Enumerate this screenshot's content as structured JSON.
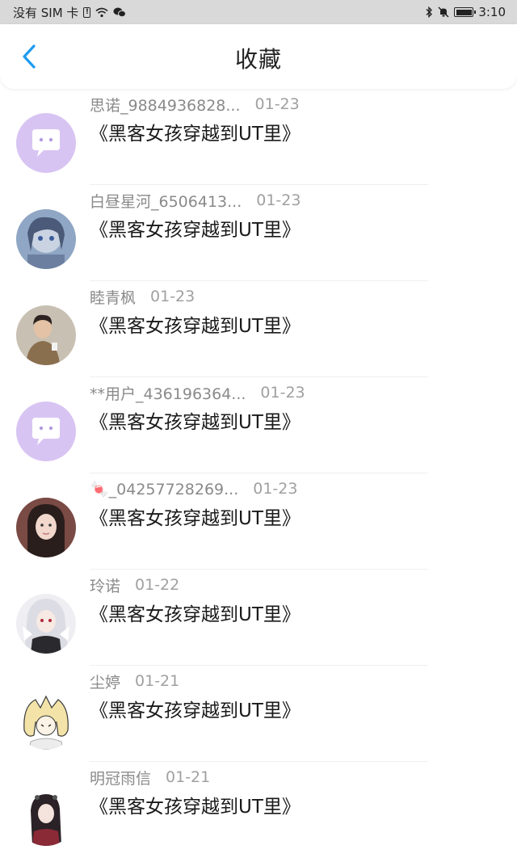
{
  "status_bar": {
    "carrier": "没有 SIM 卡",
    "time": "3:10"
  },
  "header": {
    "title": "收藏",
    "back_icon": "chevron-left-icon",
    "accent": "#1e9bf0"
  },
  "items": [
    {
      "user": "思诺_9884936828...",
      "date": "01-23",
      "title": "《黑客女孩穿越到UT里》",
      "avatar": "chat-bubble-avatar"
    },
    {
      "user": "白昼星河_6506413...",
      "date": "01-23",
      "title": "《黑客女孩穿越到UT里》",
      "avatar": "anime-avatar"
    },
    {
      "user": "睦青枫",
      "date": "01-23",
      "title": "《黑客女孩穿越到UT里》",
      "avatar": "photo-avatar"
    },
    {
      "user": "**用户_436196364...",
      "date": "01-23",
      "title": "《黑客女孩穿越到UT里》",
      "avatar": "chat-bubble-avatar"
    },
    {
      "user": "🍬_04257728269...",
      "date": "01-23",
      "title": "《黑客女孩穿越到UT里》",
      "avatar": "photo-avatar"
    },
    {
      "user": "玲诺",
      "date": "01-22",
      "title": "《黑客女孩穿越到UT里》",
      "avatar": "anime-avatar"
    },
    {
      "user": "尘婷",
      "date": "01-21",
      "title": "《黑客女孩穿越到UT里》",
      "avatar": "anime-avatar"
    },
    {
      "user": "明冠雨信",
      "date": "01-21",
      "title": "《黑客女孩穿越到UT里》",
      "avatar": "anime-avatar"
    }
  ]
}
